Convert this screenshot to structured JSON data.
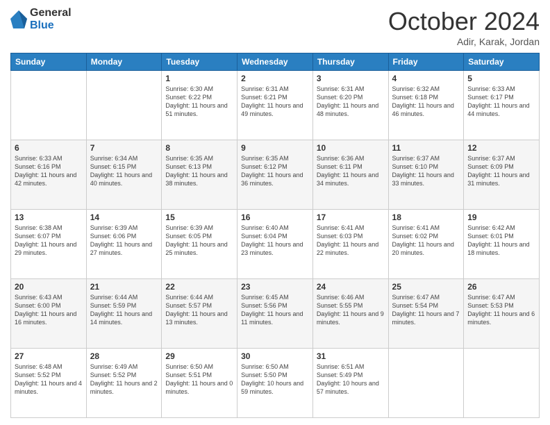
{
  "logo": {
    "general": "General",
    "blue": "Blue"
  },
  "header": {
    "month": "October 2024",
    "location": "Adir, Karak, Jordan"
  },
  "weekdays": [
    "Sunday",
    "Monday",
    "Tuesday",
    "Wednesday",
    "Thursday",
    "Friday",
    "Saturday"
  ],
  "weeks": [
    [
      {
        "day": "",
        "info": ""
      },
      {
        "day": "",
        "info": ""
      },
      {
        "day": "1",
        "info": "Sunrise: 6:30 AM\nSunset: 6:22 PM\nDaylight: 11 hours and 51 minutes."
      },
      {
        "day": "2",
        "info": "Sunrise: 6:31 AM\nSunset: 6:21 PM\nDaylight: 11 hours and 49 minutes."
      },
      {
        "day": "3",
        "info": "Sunrise: 6:31 AM\nSunset: 6:20 PM\nDaylight: 11 hours and 48 minutes."
      },
      {
        "day": "4",
        "info": "Sunrise: 6:32 AM\nSunset: 6:18 PM\nDaylight: 11 hours and 46 minutes."
      },
      {
        "day": "5",
        "info": "Sunrise: 6:33 AM\nSunset: 6:17 PM\nDaylight: 11 hours and 44 minutes."
      }
    ],
    [
      {
        "day": "6",
        "info": "Sunrise: 6:33 AM\nSunset: 6:16 PM\nDaylight: 11 hours and 42 minutes."
      },
      {
        "day": "7",
        "info": "Sunrise: 6:34 AM\nSunset: 6:15 PM\nDaylight: 11 hours and 40 minutes."
      },
      {
        "day": "8",
        "info": "Sunrise: 6:35 AM\nSunset: 6:13 PM\nDaylight: 11 hours and 38 minutes."
      },
      {
        "day": "9",
        "info": "Sunrise: 6:35 AM\nSunset: 6:12 PM\nDaylight: 11 hours and 36 minutes."
      },
      {
        "day": "10",
        "info": "Sunrise: 6:36 AM\nSunset: 6:11 PM\nDaylight: 11 hours and 34 minutes."
      },
      {
        "day": "11",
        "info": "Sunrise: 6:37 AM\nSunset: 6:10 PM\nDaylight: 11 hours and 33 minutes."
      },
      {
        "day": "12",
        "info": "Sunrise: 6:37 AM\nSunset: 6:09 PM\nDaylight: 11 hours and 31 minutes."
      }
    ],
    [
      {
        "day": "13",
        "info": "Sunrise: 6:38 AM\nSunset: 6:07 PM\nDaylight: 11 hours and 29 minutes."
      },
      {
        "day": "14",
        "info": "Sunrise: 6:39 AM\nSunset: 6:06 PM\nDaylight: 11 hours and 27 minutes."
      },
      {
        "day": "15",
        "info": "Sunrise: 6:39 AM\nSunset: 6:05 PM\nDaylight: 11 hours and 25 minutes."
      },
      {
        "day": "16",
        "info": "Sunrise: 6:40 AM\nSunset: 6:04 PM\nDaylight: 11 hours and 23 minutes."
      },
      {
        "day": "17",
        "info": "Sunrise: 6:41 AM\nSunset: 6:03 PM\nDaylight: 11 hours and 22 minutes."
      },
      {
        "day": "18",
        "info": "Sunrise: 6:41 AM\nSunset: 6:02 PM\nDaylight: 11 hours and 20 minutes."
      },
      {
        "day": "19",
        "info": "Sunrise: 6:42 AM\nSunset: 6:01 PM\nDaylight: 11 hours and 18 minutes."
      }
    ],
    [
      {
        "day": "20",
        "info": "Sunrise: 6:43 AM\nSunset: 6:00 PM\nDaylight: 11 hours and 16 minutes."
      },
      {
        "day": "21",
        "info": "Sunrise: 6:44 AM\nSunset: 5:59 PM\nDaylight: 11 hours and 14 minutes."
      },
      {
        "day": "22",
        "info": "Sunrise: 6:44 AM\nSunset: 5:57 PM\nDaylight: 11 hours and 13 minutes."
      },
      {
        "day": "23",
        "info": "Sunrise: 6:45 AM\nSunset: 5:56 PM\nDaylight: 11 hours and 11 minutes."
      },
      {
        "day": "24",
        "info": "Sunrise: 6:46 AM\nSunset: 5:55 PM\nDaylight: 11 hours and 9 minutes."
      },
      {
        "day": "25",
        "info": "Sunrise: 6:47 AM\nSunset: 5:54 PM\nDaylight: 11 hours and 7 minutes."
      },
      {
        "day": "26",
        "info": "Sunrise: 6:47 AM\nSunset: 5:53 PM\nDaylight: 11 hours and 6 minutes."
      }
    ],
    [
      {
        "day": "27",
        "info": "Sunrise: 6:48 AM\nSunset: 5:52 PM\nDaylight: 11 hours and 4 minutes."
      },
      {
        "day": "28",
        "info": "Sunrise: 6:49 AM\nSunset: 5:52 PM\nDaylight: 11 hours and 2 minutes."
      },
      {
        "day": "29",
        "info": "Sunrise: 6:50 AM\nSunset: 5:51 PM\nDaylight: 11 hours and 0 minutes."
      },
      {
        "day": "30",
        "info": "Sunrise: 6:50 AM\nSunset: 5:50 PM\nDaylight: 10 hours and 59 minutes."
      },
      {
        "day": "31",
        "info": "Sunrise: 6:51 AM\nSunset: 5:49 PM\nDaylight: 10 hours and 57 minutes."
      },
      {
        "day": "",
        "info": ""
      },
      {
        "day": "",
        "info": ""
      }
    ]
  ]
}
